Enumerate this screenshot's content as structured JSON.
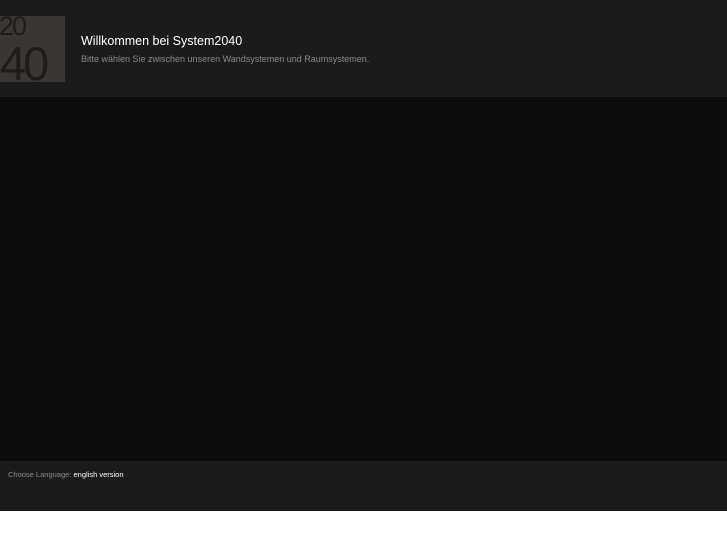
{
  "header": {
    "logo": {
      "top_text": "20",
      "bottom_text": "40"
    },
    "title": "Willkommen bei System2040",
    "subtitle": "Bitte wählen Sie zwischen unseren Wandsystemen und Raumsystemen."
  },
  "footer": {
    "language_label": "Choose Language:",
    "language_link": "english version"
  },
  "colors": {
    "header_bg": "#1b1b1b",
    "main_bg": "#0c0c0c",
    "logo_bg": "#3a3634"
  }
}
